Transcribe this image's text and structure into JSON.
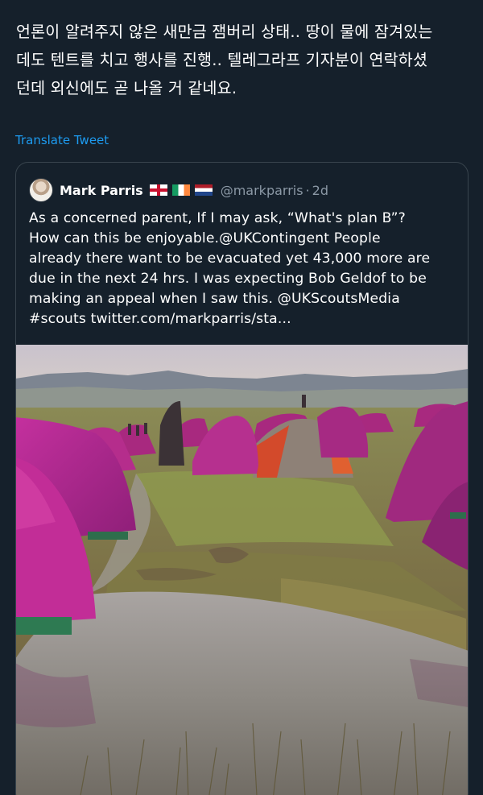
{
  "tweet": {
    "text_lines": [
      "언론이 알려주지 않은 새만금 잼버리 상태.. 땅이 물에 잠겨있는",
      "데도 텐트를 치고 행사를 진행.. 텔레그라프 기자분이 연락하셨",
      "던데 외신에도 곧 나올 거 같네요."
    ],
    "translate_label": "Translate Tweet"
  },
  "quoted": {
    "author_name": "Mark Parris",
    "flags": [
      "england-flag",
      "ireland-flag",
      "netherlands-flag"
    ],
    "handle": "@markparris",
    "separator": "·",
    "age": "2d",
    "text_lines": [
      "As a concerned parent, If I may ask, “What's plan B”?",
      "How can this be enjoyable.@UKContingent People",
      "already there want to be evacuated yet 43,000 more are",
      "due in the next 24 hrs.  I was expecting Bob Geldof to be",
      "making an appeal when I saw this. @UKScoutsMedia",
      "#scouts twitter.com/markparris/sta..."
    ]
  },
  "colors": {
    "background": "#15202b",
    "link": "#1d9bf0",
    "muted": "#8b98a5",
    "border": "#38444d",
    "tent": "#b0268e"
  }
}
